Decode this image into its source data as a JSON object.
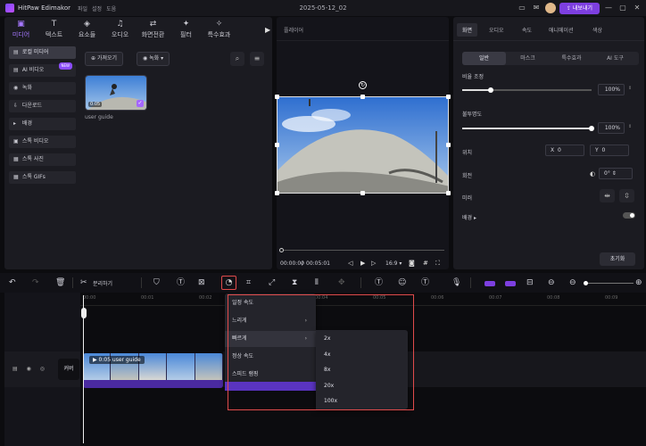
{
  "titlebar": {
    "app_name": "HitPaw Edimakor",
    "menus": [
      "파일",
      "설정",
      "도움"
    ],
    "project_title": "2025-05-12_02",
    "export_label": "내보내기"
  },
  "media_tabs": [
    {
      "label": "미디어",
      "icon": "media-icon",
      "glyph": "▣",
      "active": true
    },
    {
      "label": "텍스트",
      "icon": "text-icon",
      "glyph": "T",
      "active": false
    },
    {
      "label": "요소들",
      "icon": "elements-icon",
      "glyph": "◈",
      "active": false
    },
    {
      "label": "오디오",
      "icon": "audio-icon",
      "glyph": "♫",
      "active": false
    },
    {
      "label": "화면전환",
      "icon": "transition-icon",
      "glyph": "⇄",
      "active": false
    },
    {
      "label": "필터",
      "icon": "filter-icon",
      "glyph": "✦",
      "active": false
    },
    {
      "label": "특수효과",
      "icon": "effects-icon",
      "glyph": "✧",
      "active": false
    }
  ],
  "categories": [
    {
      "label": "로컬 미디어",
      "glyph": "▤",
      "active": true
    },
    {
      "label": "AI 비디오",
      "glyph": "▤",
      "active": false,
      "badge": "NEW"
    },
    {
      "label": "녹화",
      "glyph": "◉",
      "active": false
    },
    {
      "label": "다운로드",
      "glyph": "⇩",
      "active": false
    },
    {
      "label": "배경",
      "glyph": "▸",
      "active": false
    },
    {
      "label": "스톡 비디오",
      "glyph": "▣",
      "active": false
    },
    {
      "label": "스톡 사진",
      "glyph": "▦",
      "active": false
    },
    {
      "label": "스톡 GIFs",
      "glyph": "▦",
      "active": false
    }
  ],
  "media_actions": {
    "import_label": "가져오기",
    "record_label": "녹화"
  },
  "media_item": {
    "duration": "0:05",
    "name": "user guide"
  },
  "player": {
    "label": "플레이어",
    "current_time": "00:00:00",
    "total_time": "00:05:01",
    "aspect": "16:9"
  },
  "properties": {
    "tabs": [
      {
        "label": "화면",
        "active": true
      },
      {
        "label": "오디오",
        "active": false
      },
      {
        "label": "속도",
        "active": false
      },
      {
        "label": "애니메이션",
        "active": false
      },
      {
        "label": "색상",
        "active": false
      }
    ],
    "subtabs": [
      {
        "label": "일반",
        "active": true
      },
      {
        "label": "마스크",
        "active": false
      },
      {
        "label": "특수효과",
        "active": false
      },
      {
        "label": "AI 도구",
        "active": false
      }
    ],
    "scale_label": "비율 조정",
    "scale_value": "100%",
    "scale_fraction": 0.22,
    "opacity_label": "불투명도",
    "opacity_value": "100%",
    "opacity_fraction": 1.0,
    "position_label": "위치",
    "pos_x_label": "X",
    "pos_x": "0",
    "pos_y_label": "Y",
    "pos_y": "0",
    "rotation_label": "회전",
    "rotation_value": "0°",
    "mirror_label": "미러",
    "background_label": "배경",
    "reset_label": "초기화"
  },
  "toolbar": {
    "split_label": "분리하기"
  },
  "timeline": {
    "ruler": [
      "00:00",
      "00:01",
      "00:02",
      "00:03",
      "00:04",
      "00:05",
      "00:06",
      "00:07",
      "00:08",
      "00:09"
    ],
    "track_label": "커버",
    "clip_title": "0:05 user guide"
  },
  "speed_menu": {
    "items": [
      {
        "label": "일정 속도",
        "has_submenu": false,
        "hover": false
      },
      {
        "label": "느리게",
        "has_submenu": true,
        "hover": false
      },
      {
        "label": "빠르게",
        "has_submenu": true,
        "hover": true
      },
      {
        "label": "정상 속도",
        "has_submenu": false,
        "hover": false
      },
      {
        "label": "스피드 램핑",
        "has_submenu": false,
        "hover": false
      }
    ],
    "submenu_items": [
      "2x",
      "4x",
      "8x",
      "20x",
      "100x"
    ]
  },
  "colors": {
    "accent": "#7d3fe0",
    "highlight": "#a678ff",
    "annotation": "#e04b4b"
  }
}
